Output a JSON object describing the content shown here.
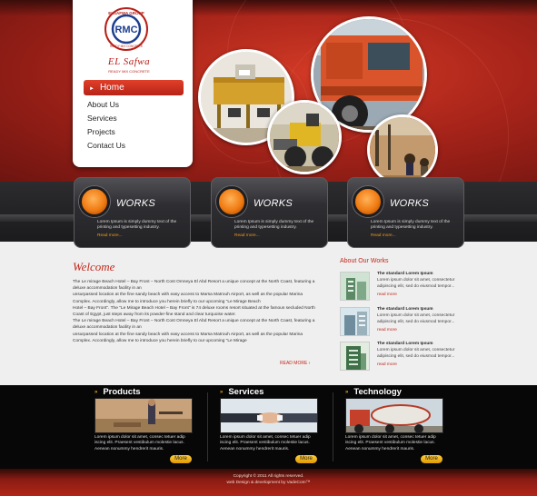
{
  "logo": {
    "seal_ring_text": "ELSAFWA GROUP",
    "seal_center": "RMC",
    "seal_bottom_text": "READY MIX CONCRETE",
    "script_name": "EL Safwa",
    "tagline": "READY MIX CONCRETE"
  },
  "nav": {
    "items": [
      "Home",
      "About Us",
      "Services",
      "Projects",
      "Contact Us"
    ],
    "active": "Home"
  },
  "works": [
    {
      "title": "WORKS",
      "text": "Lorem Ipsum is simply dummy text of the printing and typesetting industry.",
      "more": "Read more..."
    },
    {
      "title": "WORKS",
      "text": "Lorem Ipsum is simply dummy text of the printing and typesetting industry.",
      "more": "Read more..."
    },
    {
      "title": "WORKS",
      "text": "Lorem Ipsum is simply dummy text of the printing and typesetting industry.",
      "more": "Read more..."
    }
  ],
  "welcome": {
    "title": "Welcome",
    "paragraphs": [
      "The Le mirage Beach Hotel – Bay Front – North Cost Omneya El Abd Resort a unique concept at the North Coast, featuring a deluxe accommodation facility in an",
      "unsurpassed location at the fine sandy beach with easy access to Marsa Matrouh Airport, as well as the popular Marina Complex. Accordingly, allow me to introduce you herein briefly to our upcoming \"Le Mirage Beach",
      "Hotel – Bay Front\". The \"Le Mirage Beach Hotel – Bay Front\" is 74 deluxe rooms resort situated at the famous secluded North Coast of Egypt, just steps away from its powder-fine stand and clear turquoise water.",
      "The Le mirage Beach Hotel – Bay Front – North Cost Omneya El Abd Resort a unique concept at the North Coast, featuring a deluxe accommodation facility in an",
      "unsurpassed location at the fine sandy beach with easy access to Marsa Matrouh Airport, as well as the popular Marina Complex. Accordingly, allow me to introduce you herein briefly to our upcoming \"Le Mirage"
    ],
    "more": "READ MORE"
  },
  "about_works": {
    "title": "About Our Works",
    "items": [
      {
        "head": "The standard Lorem Ipsum",
        "text": "Lorem ipsum dolor sit amet, consectetur adipiscing elit, sed do eiusmod tempor...",
        "more": "read more"
      },
      {
        "head": "The standard Lorem Ipsum",
        "text": "Lorem ipsum dolor sit amet, consectetur adipiscing elit, sed do eiusmod tempor...",
        "more": "read more"
      },
      {
        "head": "The standard Lorem Ipsum",
        "text": "Lorem ipsum dolor sit amet, consectetur adipiscing elit, sed do eiusmod tempor...",
        "more": "read more"
      }
    ]
  },
  "columns": [
    {
      "title": "Products",
      "text": "Lorem ipsum dolor sit amet, consec tetuer adip iscing elit. Praesent vestibulum molestie lacus. Aenean nonummy hendrerit mauris.",
      "button": "More"
    },
    {
      "title": "Services",
      "text": "Lorem ipsum dolor sit amet, consec tetuer adip iscing elit. Praesent vestibulum molestie lacus. Aenean nonummy hendrerit mauris.",
      "button": "More"
    },
    {
      "title": "Technology",
      "text": "Lorem ipsum dolor sit amet, consec tetuer adip iscing elit. Praesent vestibulum molestie lacus. Aenean nonummy hendrerit mauris.",
      "button": "More"
    }
  ],
  "footer": {
    "copyright": "Copyright © 2011   All rights reserved.",
    "credit": "web Design & development by VadeCom™"
  },
  "colors": {
    "brand_red": "#c1291d",
    "orb_orange": "#f07b12",
    "button_yellow": "#f2b51a"
  }
}
